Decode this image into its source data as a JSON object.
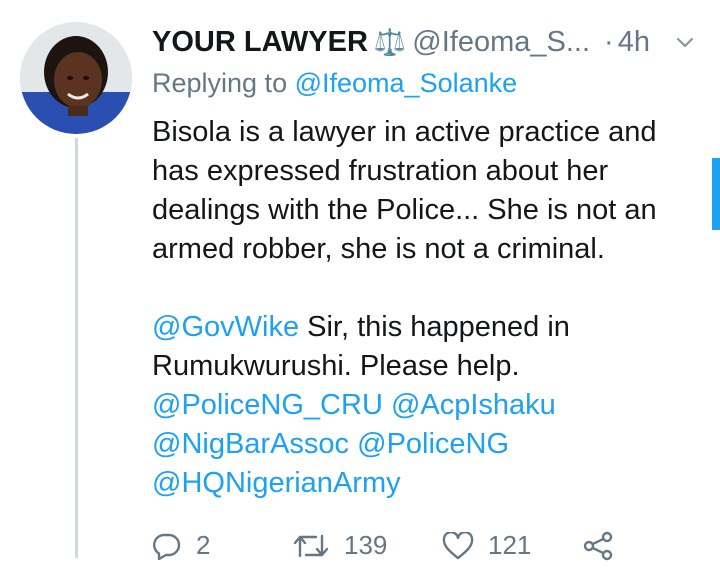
{
  "tweet": {
    "display_name": "YOUR LAWYER",
    "name_emoji": "⚖️",
    "handle": "@Ifeoma_S...",
    "separator": "·",
    "timestamp": "4h",
    "replying_prefix": "Replying to",
    "replying_handle": "@Ifeoma_Solanke",
    "paragraph1": [
      "Bisola is a lawyer in active practice and",
      "has expressed frustration about her",
      "dealings with the Police... She is not an",
      "armed robber, she is not a criminal."
    ],
    "mention_govwike": "@GovWike",
    "line_sir": " Sir, this happened in",
    "line_rumu": "Rumukwurushi. Please help.",
    "mention_policeng_cru": "@PoliceNG_CRU",
    "mention_acpishaku": "@AcpIshaku",
    "mention_nigbarassoc": "@NigBarAssoc",
    "mention_policeng": "@PoliceNG",
    "mention_hqnigerianarmy": "@HQNigerianArmy"
  },
  "actions": {
    "reply_count": "2",
    "retweet_count": "139",
    "like_count": "121"
  },
  "icons": {
    "reply": "reply-icon",
    "retweet": "retweet-icon",
    "like": "heart-icon",
    "share": "share-icon",
    "more": "chevron-down-icon"
  },
  "colors": {
    "link": "#1da1f2",
    "text": "#14171a",
    "secondary": "#657786",
    "thread_line": "#cfd9de"
  }
}
